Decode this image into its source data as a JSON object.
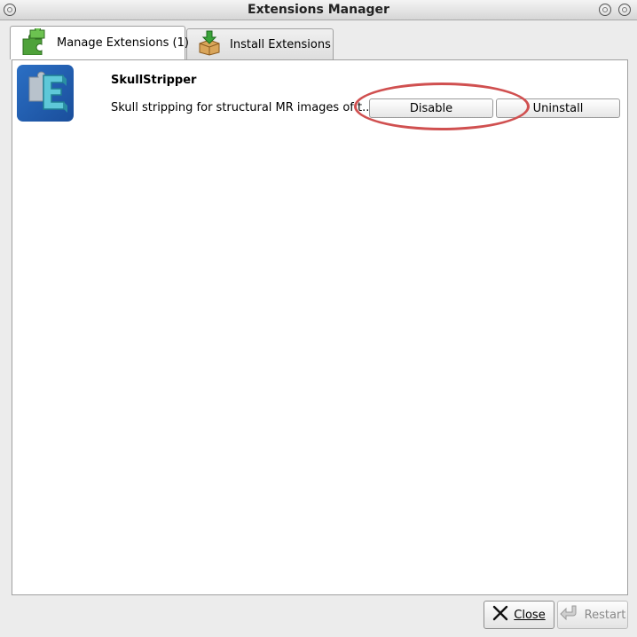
{
  "window": {
    "title": "Extensions Manager"
  },
  "tabs": [
    {
      "label": "Manage Extensions (1)",
      "icon": "puzzle-icon",
      "active": true
    },
    {
      "label": "Install Extensions",
      "icon": "install-box-icon",
      "active": false
    }
  ],
  "extensions": [
    {
      "name": "SkullStripper",
      "description": "Skull stripping for structural MR images of t...",
      "icon": "extension-logo-icon",
      "disable_label": "Disable",
      "uninstall_label": "Uninstall"
    }
  ],
  "footer": {
    "close_label": "Close",
    "restart_label": "Restart",
    "restart_enabled": false
  },
  "colors": {
    "highlight_ellipse": "#d05050",
    "tab_active_bg": "#ffffff"
  }
}
